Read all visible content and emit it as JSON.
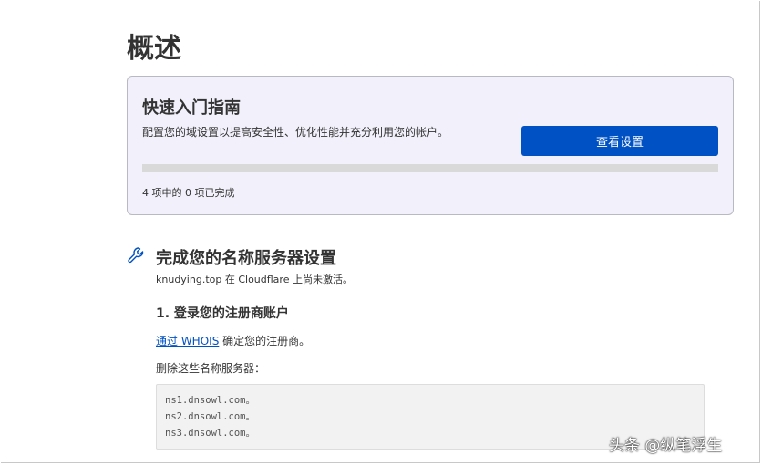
{
  "page": {
    "title": "概述"
  },
  "guide": {
    "title": "快速入门指南",
    "description": "配置您的域设置以提高安全性、优化性能并充分利用您的帐户。",
    "button": "查看设置",
    "progress_fraction": 0,
    "progress_text": "4 项中的 0 项已完成"
  },
  "nameservers": {
    "icon": "wrench-icon",
    "title": "完成您的名称服务器设置",
    "subtitle": "knudying.top 在 Cloudflare 上尚未激活。",
    "step1": "1. 登录您的注册商账户",
    "link": "通过 WHOIS",
    "link_suffix": " 确定您的注册商。",
    "remove_label": "删除这些名称服务器：",
    "servers": [
      "ns1.dnsowl.com。",
      "ns2.dnsowl.com。",
      "ns3.dnsowl.com。"
    ]
  },
  "watermark": "头条 @纵笔浮生"
}
